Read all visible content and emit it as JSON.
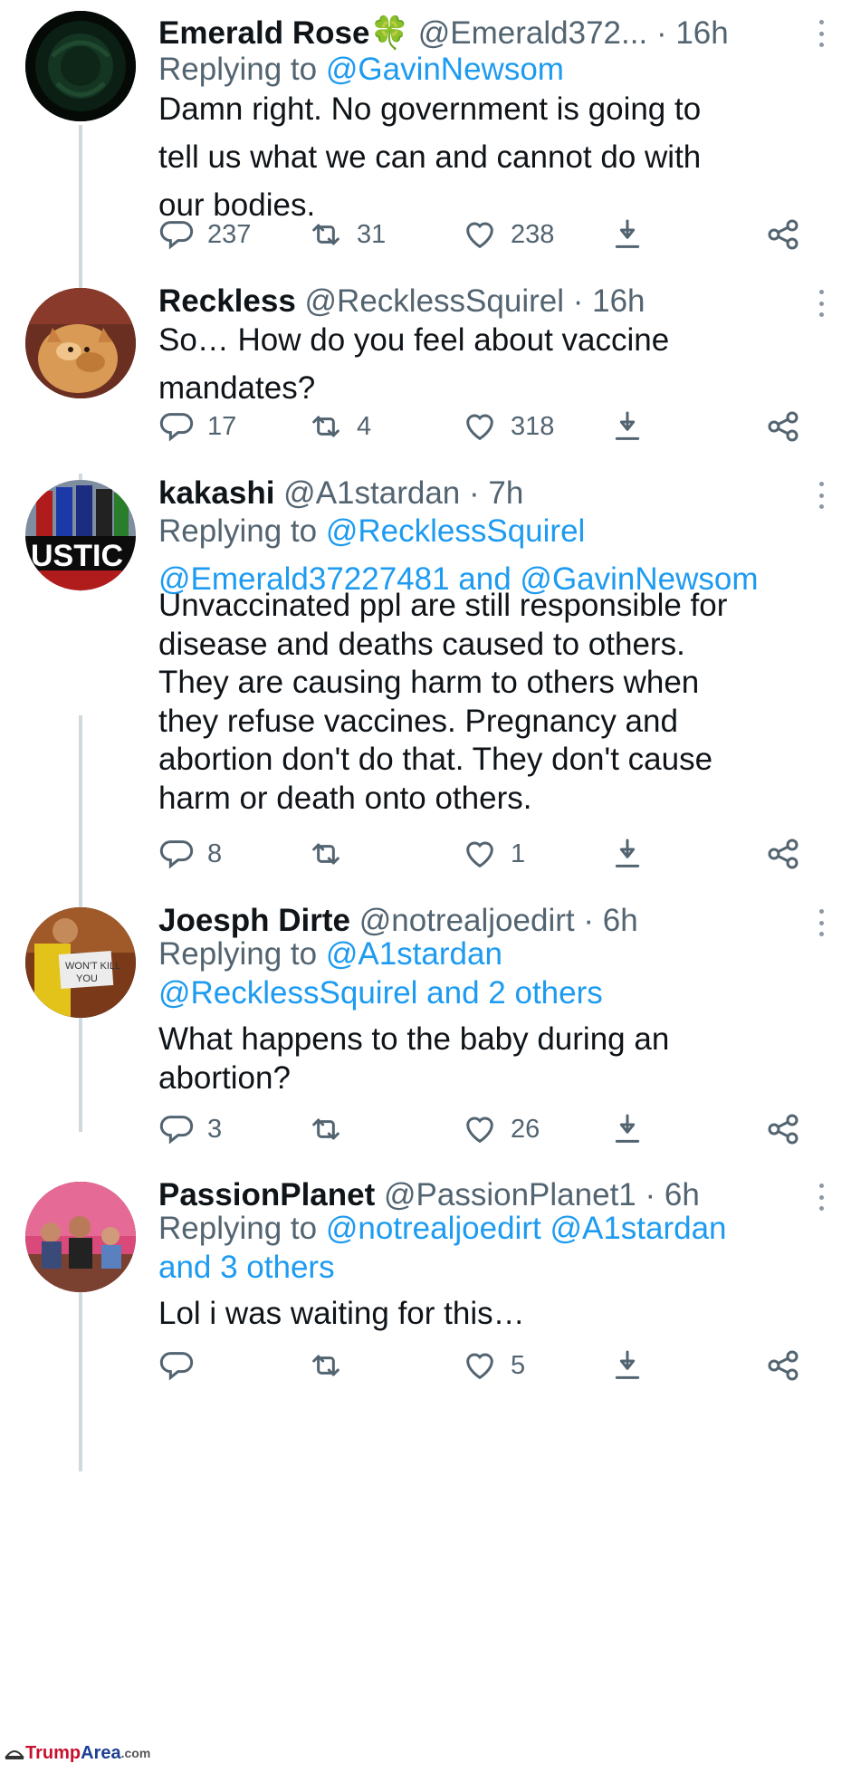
{
  "tweets": [
    {
      "name": "Emerald Rose",
      "emoji": "🍀",
      "handle": "@Emerald372...",
      "time": "16h",
      "reply_prefix": "Replying to",
      "reply_line1": "@GavinNewsom",
      "reply_line2": "",
      "text_lines": [
        "Damn right. No government is going to",
        "tell us what we can and cannot do with",
        "our bodies."
      ],
      "replies": "237",
      "retweets": "31",
      "likes": "238"
    },
    {
      "name": "Reckless",
      "handle": "@RecklessSquirel",
      "time": "16h",
      "text_lines": [
        "So… How do you feel about vaccine",
        "mandates?"
      ],
      "replies": "17",
      "retweets": "4",
      "likes": "318"
    },
    {
      "name": "kakashi",
      "handle": "@A1stardan",
      "time": "7h",
      "reply_prefix": "Replying to",
      "reply_line1": "@RecklessSquirel",
      "reply_line2": "@Emerald37227481 and @GavinNewsom",
      "text_lines": [
        "Unvaccinated ppl are still responsible for",
        "disease and deaths caused to others.",
        "They are causing harm to others when",
        "they refuse vaccines. Pregnancy and",
        "abortion don't do that. They don't cause",
        "harm or death onto others."
      ],
      "replies": "8",
      "retweets": "",
      "likes": "1"
    },
    {
      "name": "Joesph Dirte",
      "handle": "@notrealjoedirt",
      "time": "6h",
      "reply_prefix": "Replying to",
      "reply_line1": "@A1stardan",
      "reply_line2": "@RecklessSquirel and 2 others",
      "text_lines": [
        "What happens to the baby during an",
        "abortion?"
      ],
      "replies": "3",
      "retweets": "",
      "likes": "26"
    },
    {
      "name": "PassionPlanet",
      "handle": "@PassionPlanet1",
      "time": "6h",
      "reply_prefix": "Replying to",
      "reply_line1": "@notrealjoedirt @A1stardan",
      "reply_line2": "and 3 others",
      "text_lines": [
        "Lol i was waiting for this…"
      ],
      "replies": "",
      "retweets": "",
      "likes": "5"
    }
  ],
  "separator": "·",
  "watermark": {
    "part1": "Trump",
    "part2": "Area",
    "part3": ".com"
  },
  "colors": {
    "link": "#1d9bf0",
    "muted": "#536471",
    "text": "#0f1419",
    "thread": "#cfd9de"
  }
}
